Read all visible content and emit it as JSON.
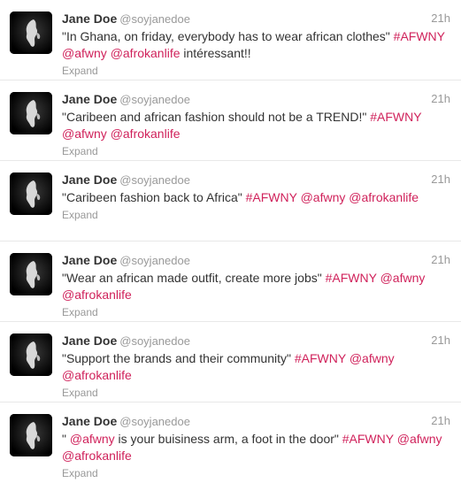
{
  "colors": {
    "link": "#d0225b",
    "meta": "#999999",
    "text": "#333333"
  },
  "tweets": [
    {
      "name": "Jane Doe",
      "handle": "@soyjanedoe",
      "time": "21h",
      "parts": [
        {
          "t": "\"In Ghana, on friday, everybody has to wear african clothes\" "
        },
        {
          "t": "#AFWNY",
          "link": true
        },
        {
          "t": " "
        },
        {
          "t": "@afwny",
          "link": true
        },
        {
          "t": " "
        },
        {
          "t": "@afrokanlife",
          "link": true
        },
        {
          "t": " intéressant!!"
        }
      ],
      "expand": "Expand"
    },
    {
      "name": "Jane Doe",
      "handle": "@soyjanedoe",
      "time": "21h",
      "parts": [
        {
          "t": "\"Caribeen and african fashion should not be a TREND!\" "
        },
        {
          "t": "#AFWNY",
          "link": true
        },
        {
          "t": " "
        },
        {
          "t": "@afwny",
          "link": true
        },
        {
          "t": " "
        },
        {
          "t": "@afrokanlife",
          "link": true
        }
      ],
      "expand": "Expand"
    },
    {
      "name": "Jane Doe",
      "handle": "@soyjanedoe",
      "time": "21h",
      "parts": [
        {
          "t": "\"Caribeen fashion back to Africa\" "
        },
        {
          "t": "#AFWNY",
          "link": true
        },
        {
          "t": " "
        },
        {
          "t": "@afwny",
          "link": true
        },
        {
          "t": " "
        },
        {
          "t": "@afrokanlife",
          "link": true
        }
      ],
      "expand": "Expand"
    },
    {
      "name": "Jane Doe",
      "handle": "@soyjanedoe",
      "time": "21h",
      "parts": [
        {
          "t": "\"Wear an african made outfit, create more jobs\" "
        },
        {
          "t": "#AFWNY",
          "link": true
        },
        {
          "t": " "
        },
        {
          "t": "@afwny",
          "link": true
        },
        {
          "t": " "
        },
        {
          "t": "@afrokanlife",
          "link": true
        }
      ],
      "expand": "Expand"
    },
    {
      "name": "Jane Doe",
      "handle": "@soyjanedoe",
      "time": "21h",
      "parts": [
        {
          "t": "\"Support the brands and their community\" "
        },
        {
          "t": "#AFWNY",
          "link": true
        },
        {
          "t": " "
        },
        {
          "t": "@afwny",
          "link": true
        },
        {
          "t": " "
        },
        {
          "t": "@afrokanlife",
          "link": true
        }
      ],
      "expand": "Expand"
    },
    {
      "name": "Jane Doe",
      "handle": "@soyjanedoe",
      "time": "21h",
      "parts": [
        {
          "t": "\" "
        },
        {
          "t": "@afwny",
          "link": true
        },
        {
          "t": " is your buisiness arm, a foot in the door\" "
        },
        {
          "t": "#AFWNY",
          "link": true
        },
        {
          "t": " "
        },
        {
          "t": "@afwny",
          "link": true
        },
        {
          "t": " "
        },
        {
          "t": "@afrokanlife",
          "link": true
        }
      ],
      "expand": "Expand"
    }
  ]
}
